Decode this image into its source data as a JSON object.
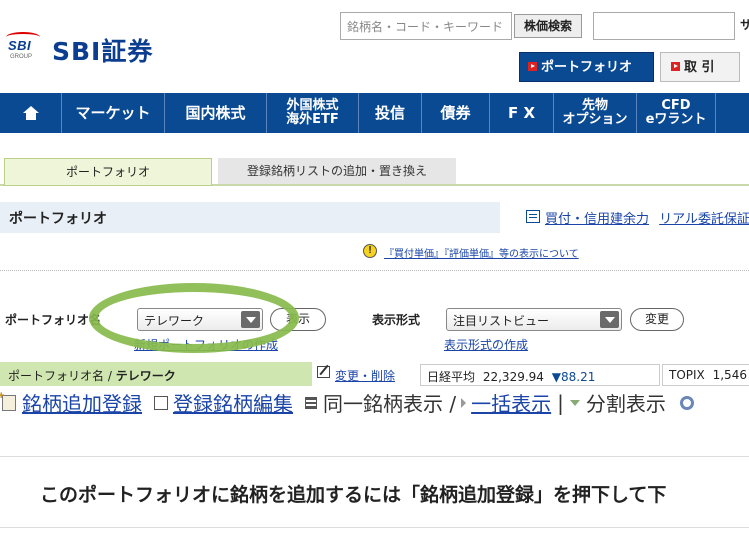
{
  "header": {
    "logo_text": "SBI",
    "logo_sub": "GROUP",
    "brand": "SBI証券",
    "search_placeholder": "銘柄名・コード・キーワード",
    "search_button": "株価検索",
    "search2_cut": "サ",
    "tab_portfolio": "ポートフォリオ",
    "tab_trade": "取 引"
  },
  "nav": {
    "items": [
      {
        "label": ""
      },
      {
        "label": "マーケット"
      },
      {
        "label": "国内株式"
      },
      {
        "label1": "外国株式",
        "label2": "海外ETF"
      },
      {
        "label": "投信"
      },
      {
        "label": "債券"
      },
      {
        "label": "F X"
      },
      {
        "label1": "先物",
        "label2": "オプション"
      },
      {
        "label1": "CFD",
        "label2": "eワラント"
      }
    ]
  },
  "page_tabs": {
    "active": "ポートフォリオ",
    "other": "登録銘柄リストの追加・置き換え"
  },
  "title": {
    "text": "ポートフォリオ",
    "link1": "買付・信用建余力",
    "link2": "リアル委託保証"
  },
  "notice": {
    "icon": "!",
    "text": "『買付単価』『評価単価』等の表示について"
  },
  "form": {
    "pf_label": "ポートフォリオ名",
    "pf_value": "テレワーク",
    "pf_show": "表示",
    "pf_create": "新規ポートフォリオの作成",
    "view_label": "表示形式",
    "view_value": "注目リストビュー",
    "view_change": "変更",
    "view_create": "表示形式の作成"
  },
  "info": {
    "pf_name_label": "ポートフォリオ名 / ",
    "pf_name_value": "テレワーク",
    "edit_link": "変更・削除",
    "nikkei_label": "日経平均",
    "nikkei_value": "22,329.94",
    "nikkei_change": "▼88.21",
    "topix_label": "TOPIX",
    "topix_value": "1,546"
  },
  "actions": {
    "add": "銘柄追加登録",
    "edit": "登録銘柄編集",
    "same": "同一銘柄表示 /",
    "bulk": "一括表示",
    "sep": "|",
    "split": "分割表示"
  },
  "message": "このポートフォリオに銘柄を追加するには「銘柄追加登録」を押下して下"
}
